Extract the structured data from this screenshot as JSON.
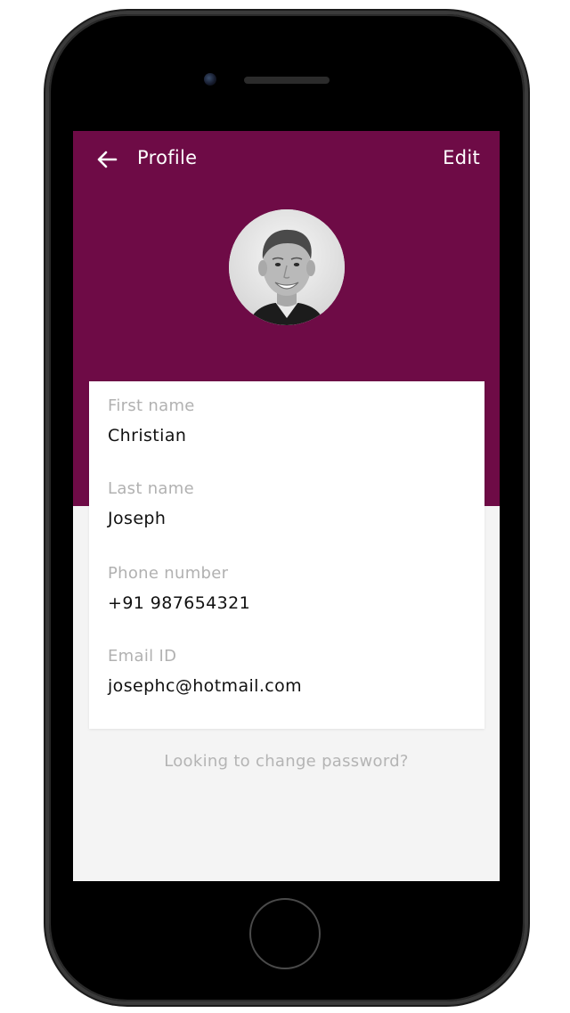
{
  "header": {
    "title": "Profile",
    "edit_label": "Edit",
    "back_icon": "arrow-left-icon"
  },
  "profile": {
    "avatar_icon": "profile-photo",
    "fields": [
      {
        "label": "First name",
        "value": "Christian"
      },
      {
        "label": "Last name",
        "value": "Joseph"
      },
      {
        "label": "Phone number",
        "value": "+91 987654321"
      },
      {
        "label": "Email ID",
        "value": "josephc@hotmail.com"
      }
    ]
  },
  "footer": {
    "change_password_label": "Looking to change password?"
  },
  "colors": {
    "brand": "#6e0b46",
    "background": "#f4f4f4",
    "card": "#ffffff",
    "label_gray": "#b1b1b1",
    "text": "#111111"
  }
}
